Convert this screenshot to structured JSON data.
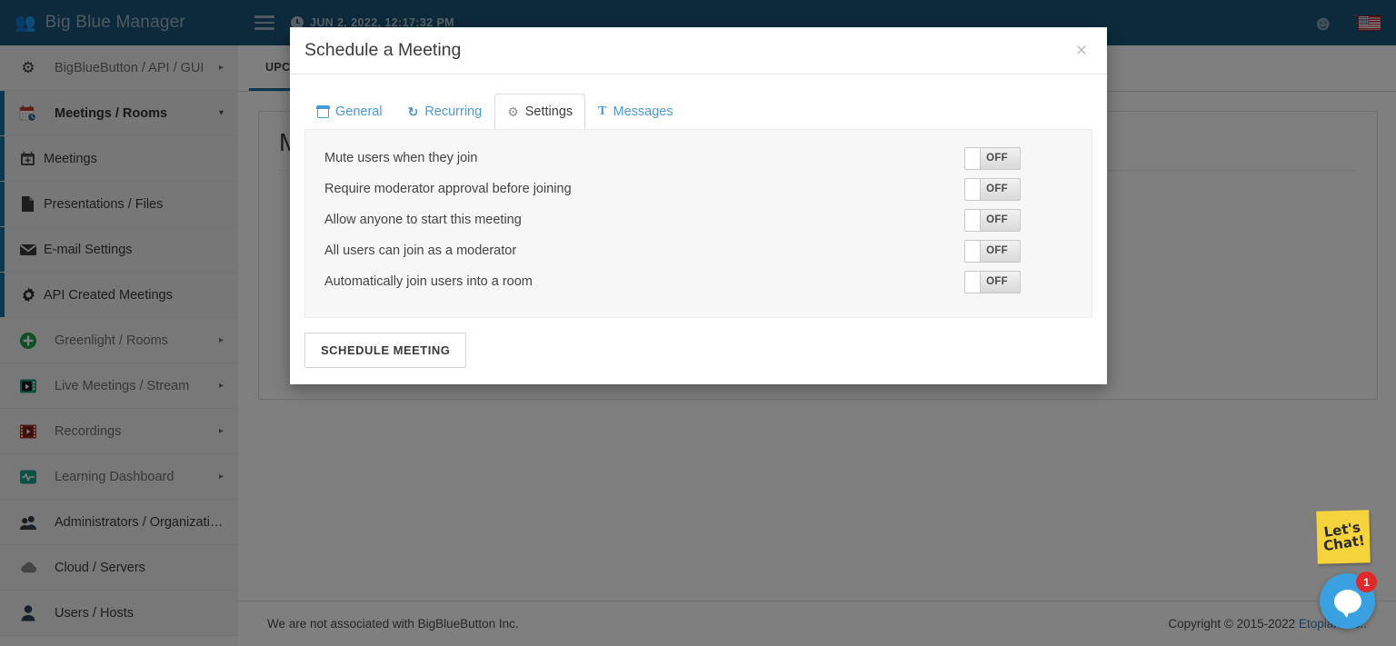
{
  "topbar": {
    "brand": "Big Blue Manager",
    "brand_icon": "users-icon",
    "menu_icon": "hamburger-icon",
    "clock_icon": "clock-icon",
    "datetime": "JUN 2, 2022, 12:17:32 PM",
    "account_icon": "account-circle-icon",
    "flag_icon": "us-flag-icon",
    "background": "#1b5479"
  },
  "sidebar": {
    "items": [
      {
        "label": "BigBlueButton / API / GUI",
        "icon": "gears-icon",
        "caret": "▸",
        "type": "parent"
      },
      {
        "label": "Meetings / Rooms",
        "icon": "calendar-clock-icon",
        "caret": "▾",
        "type": "parent-active"
      },
      {
        "label": "Meetings",
        "icon": "calendar-plus-icon",
        "caret": "",
        "type": "sub"
      },
      {
        "label": "Presentations / Files",
        "icon": "file-icon",
        "caret": "",
        "type": "sub"
      },
      {
        "label": "E-mail Settings",
        "icon": "envelope-icon",
        "caret": "",
        "type": "sub"
      },
      {
        "label": "API Created Meetings",
        "icon": "gear-icon",
        "caret": "",
        "type": "sub"
      },
      {
        "label": "Greenlight / Rooms",
        "icon": "plus-circle-icon",
        "caret": "▸",
        "type": "parent"
      },
      {
        "label": "Live Meetings / Stream",
        "icon": "video-play-icon",
        "caret": "▸",
        "type": "parent"
      },
      {
        "label": "Recordings",
        "icon": "film-icon",
        "caret": "▸",
        "type": "parent"
      },
      {
        "label": "Learning Dashboard",
        "icon": "pulse-icon",
        "caret": "▸",
        "type": "parent"
      },
      {
        "label": "Administrators / Organizati…",
        "icon": "users-icon",
        "caret": "",
        "type": "parent"
      },
      {
        "label": "Cloud / Servers",
        "icon": "cloud-icon",
        "caret": "",
        "type": "parent"
      },
      {
        "label": "Users / Hosts",
        "icon": "user-icon",
        "caret": "",
        "type": "parent"
      }
    ]
  },
  "main": {
    "tabs": [
      {
        "label": "UPCOMING",
        "active": true
      }
    ],
    "card_title": "M",
    "footer": {
      "disclaimer": "We are not associated with BigBlueButton Inc.",
      "copyright": "Copyright © 2015-2022",
      "company_link": "Etopian Inc.."
    }
  },
  "modal": {
    "title": "Schedule a Meeting",
    "close_label": "×",
    "tabs": [
      {
        "label": "General",
        "icon": "calendar-icon",
        "active": false
      },
      {
        "label": "Recurring",
        "icon": "redo-icon",
        "active": false
      },
      {
        "label": "Settings",
        "icon": "gear-icon",
        "active": true
      },
      {
        "label": "Messages",
        "icon": "text-t-icon",
        "active": false
      }
    ],
    "settings": [
      {
        "label": "Mute users when they join",
        "state": "OFF"
      },
      {
        "label": "Require moderator approval before joining",
        "state": "OFF"
      },
      {
        "label": "Allow anyone to start this meeting",
        "state": "OFF"
      },
      {
        "label": "All users can join as a moderator",
        "state": "OFF"
      },
      {
        "label": "Automatically join users into a room",
        "state": "OFF"
      }
    ],
    "submit_label": "SCHEDULE MEETING"
  },
  "chat": {
    "note_line1": "Let's",
    "note_line2": "Chat!",
    "badge_count": "1",
    "bubble_icon": "chat-bubble-icon"
  },
  "colors": {
    "brand_blue": "#1b5479",
    "accent_blue": "#1b6e9e",
    "link_blue": "#2f7bbf",
    "tab_blue": "#4a9ad4",
    "panel_gray": "#f7f7f7",
    "chat_blue": "#3aa0e0",
    "note_yellow": "#f5d33d",
    "badge_red": "#e02a2a"
  }
}
